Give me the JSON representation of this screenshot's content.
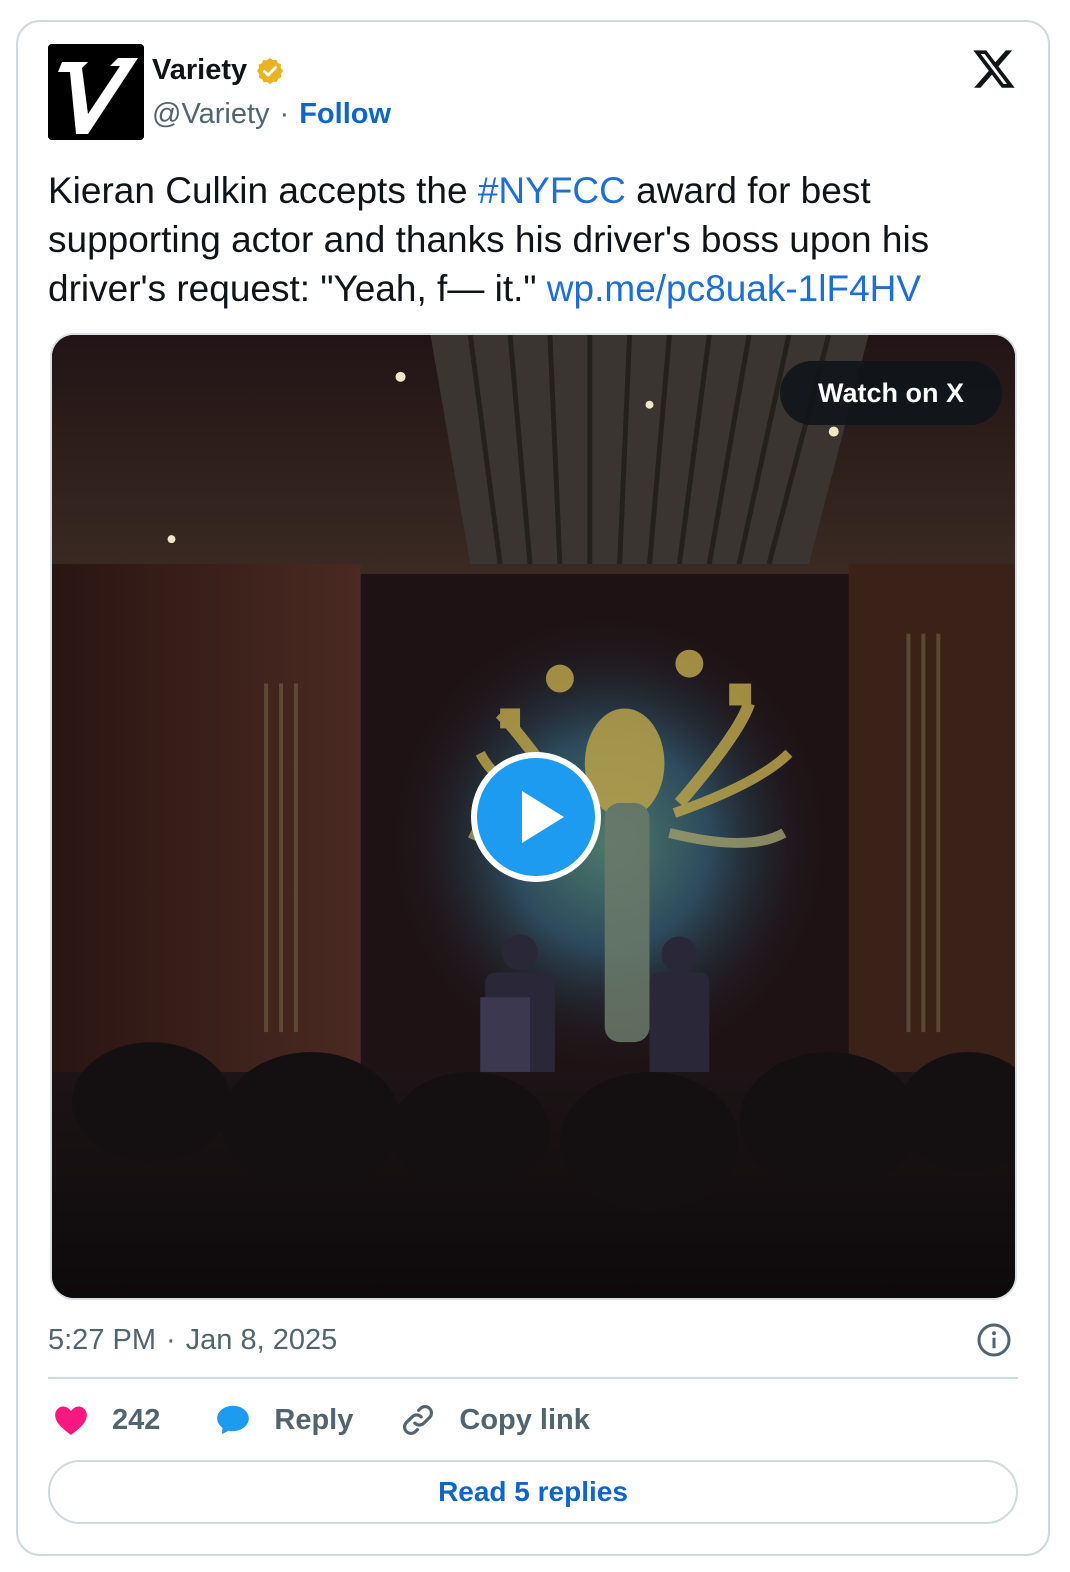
{
  "account": {
    "name": "Variety",
    "handle": "@Variety",
    "separator": "·",
    "follow_label": "Follow",
    "verified": true,
    "verified_color": "#e8b326"
  },
  "tweet": {
    "text_part1": "Kieran Culkin accepts the ",
    "hashtag": "#NYFCC",
    "text_part2": " award for best supporting actor and thanks his driver's boss upon his driver's request: \"Yeah, f— it.\" ",
    "link": "wp.me/pc8uak-1lF4HV",
    "link_color": "#1d6fd6"
  },
  "media": {
    "watch_label": "Watch on X",
    "play_color": "#1d9bf0"
  },
  "meta": {
    "time": "5:27 PM",
    "separator": "·",
    "date": "Jan 8, 2025"
  },
  "actions": {
    "likes": "242",
    "like_color": "#f91880",
    "reply_label": "Reply",
    "reply_color": "#1d9bf0",
    "copy_label": "Copy link"
  },
  "read_replies_label": "Read 5 replies"
}
